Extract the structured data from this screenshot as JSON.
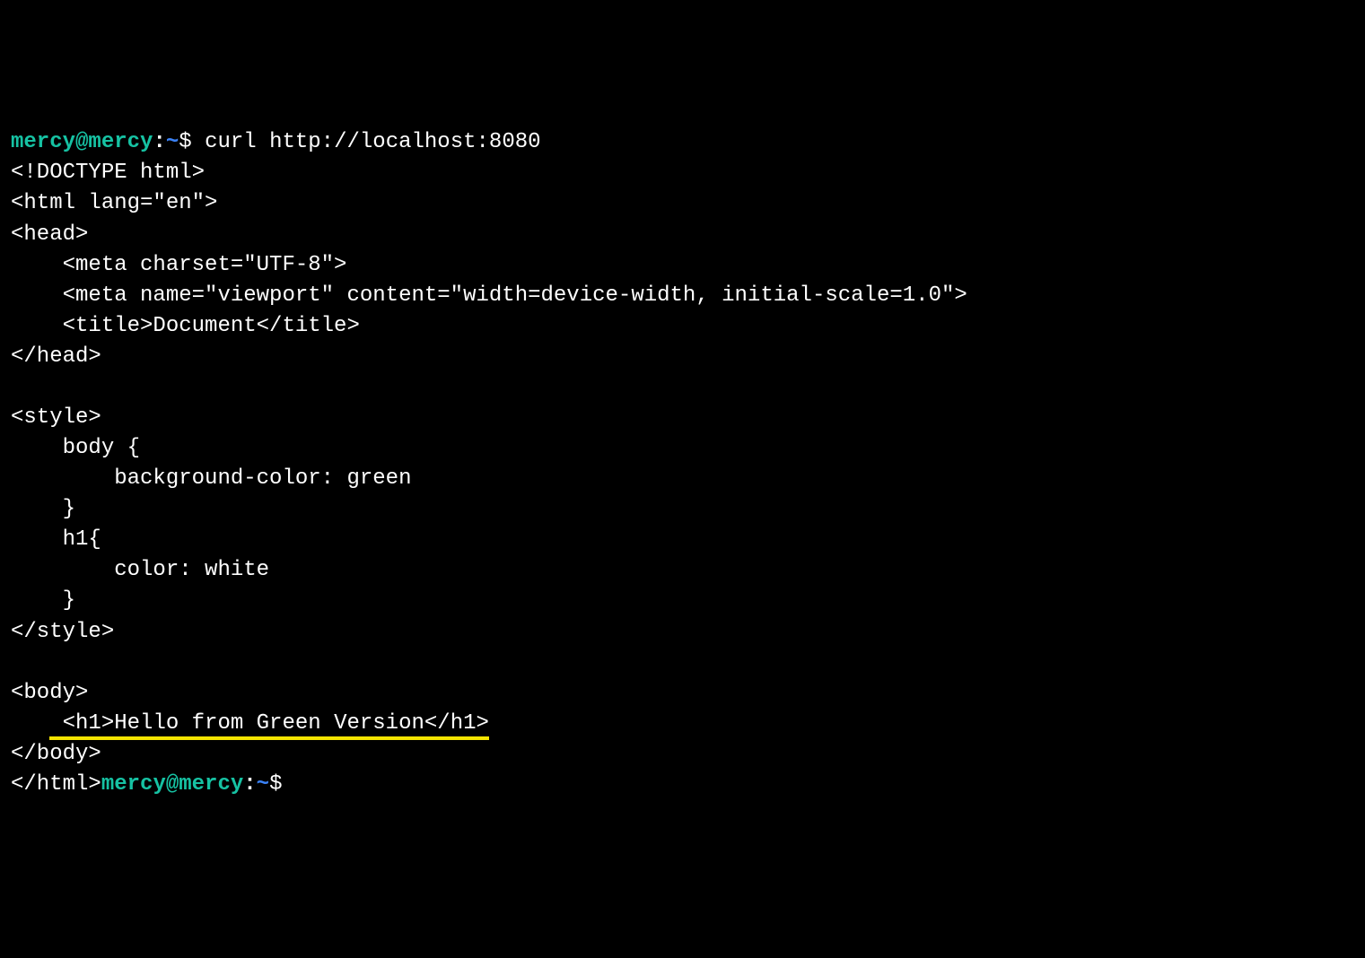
{
  "prompt": {
    "user_host": "mercy@mercy",
    "colon": ":",
    "cwd": "~",
    "sigil": "$"
  },
  "command": "curl http://localhost:8080",
  "output": {
    "l01": "<!DOCTYPE html>",
    "l02": "<html lang=\"en\">",
    "l03": "<head>",
    "l04": "    <meta charset=\"UTF-8\">",
    "l05": "    <meta name=\"viewport\" content=\"width=device-width, initial-scale=1.0\">",
    "l06": "    <title>Document</title>",
    "l07": "</head>",
    "l08": "",
    "l09": "<style>",
    "l10": "    body {",
    "l11": "        background-color: green",
    "l12": "    }",
    "l13": "    h1{",
    "l14": "        color: white",
    "l15": "    }",
    "l16": "</style>",
    "l17": "",
    "l18": "<body>",
    "l19_pre": "   ",
    "l19_hl": " <h1>Hello from Green Version</h1>",
    "l20": "</body>",
    "l21": "</html>"
  }
}
